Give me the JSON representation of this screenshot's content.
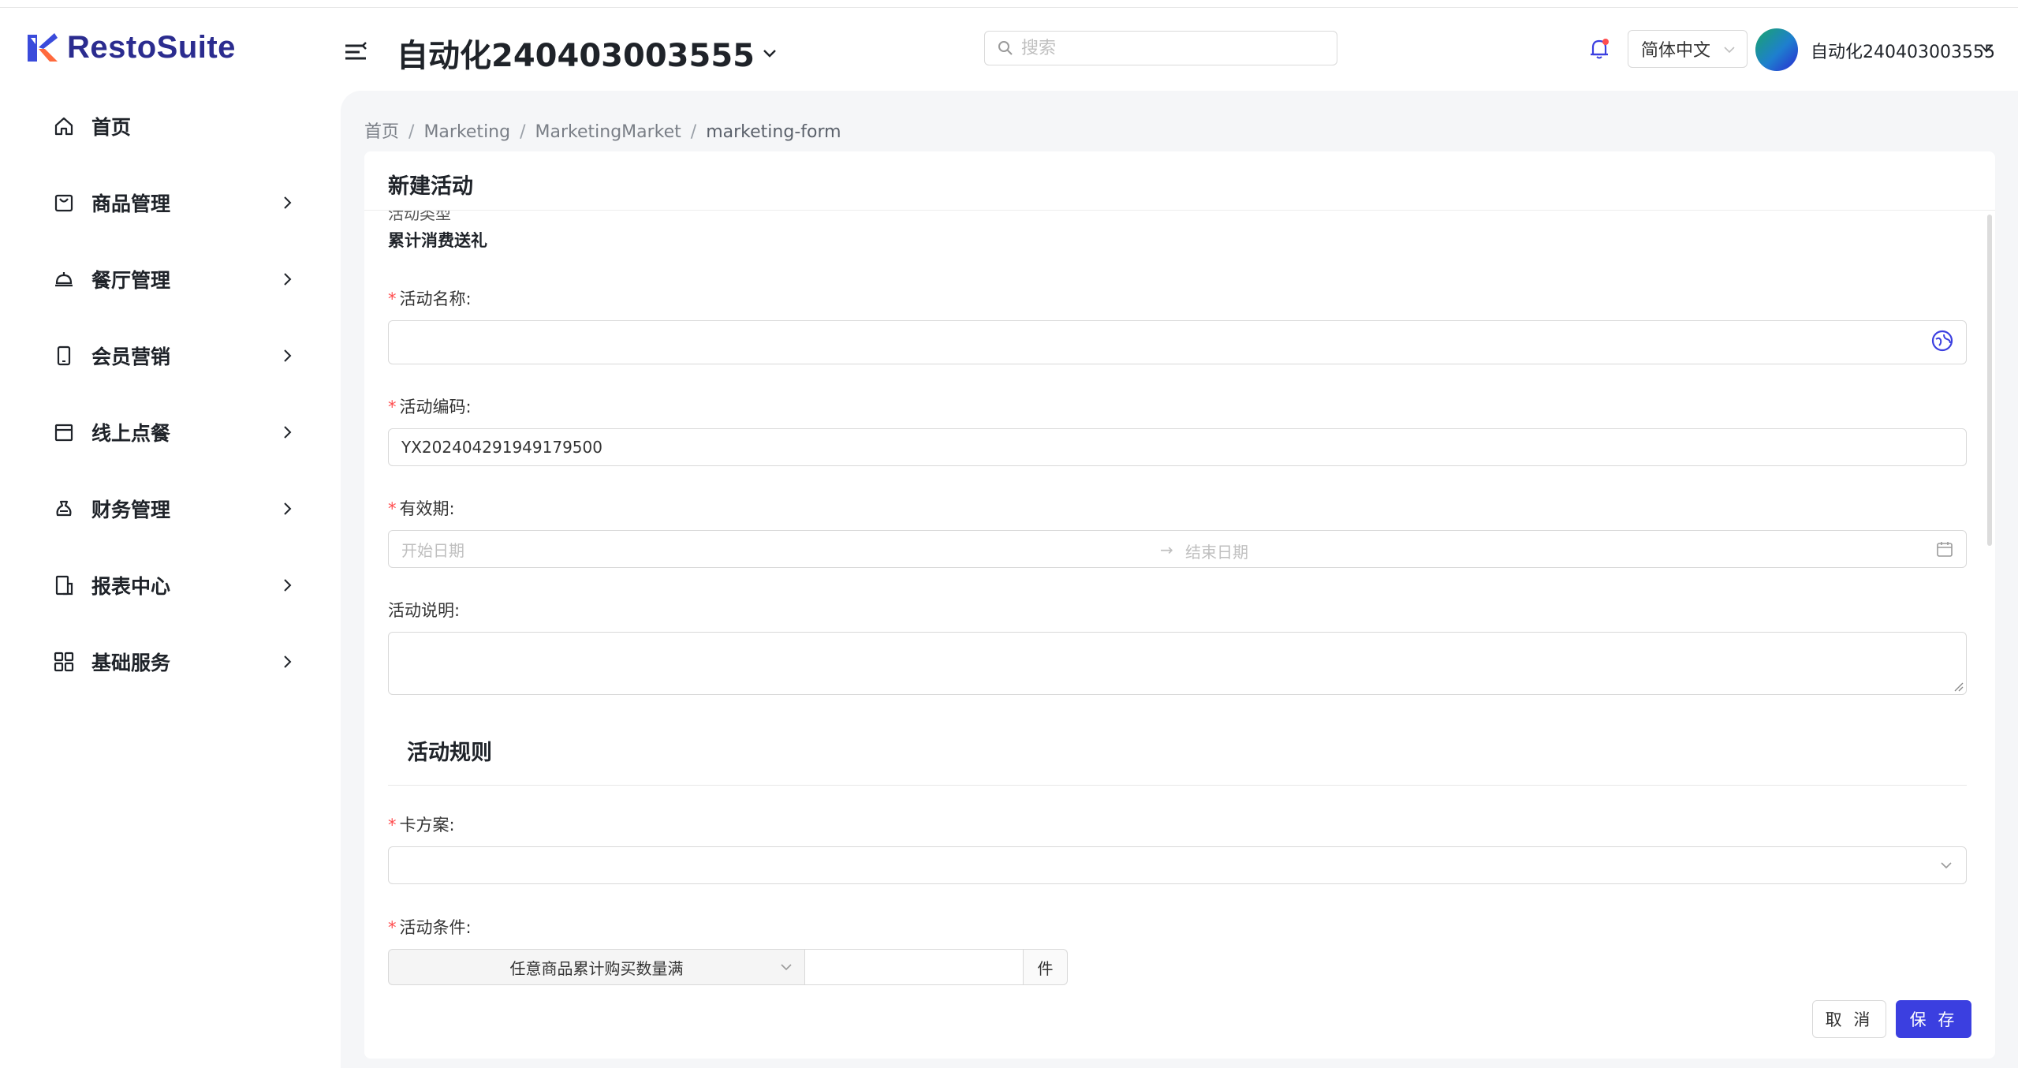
{
  "app": {
    "name": "RestoSuite"
  },
  "header": {
    "store_name": "自动化240403003555",
    "search_placeholder": "搜索",
    "language": "简体中文",
    "user_name": "自动化240403003555"
  },
  "sidebar": {
    "items": [
      {
        "label": "首页",
        "icon": "home-icon"
      },
      {
        "label": "商品管理",
        "icon": "bag-icon"
      },
      {
        "label": "餐厅管理",
        "icon": "cloche-icon"
      },
      {
        "label": "会员营销",
        "icon": "phone-icon"
      },
      {
        "label": "线上点餐",
        "icon": "store-icon"
      },
      {
        "label": "财务管理",
        "icon": "money-bag-icon"
      },
      {
        "label": "报表中心",
        "icon": "report-icon"
      },
      {
        "label": "基础服务",
        "icon": "grid-icon"
      }
    ]
  },
  "breadcrumb": [
    "首页",
    "Marketing",
    "MarketingMarket",
    "marketing-form"
  ],
  "form": {
    "title": "新建活动",
    "cut_label": "活动类型",
    "activity_type": "累计消费送礼",
    "name_label": "活动名称:",
    "name_value": "",
    "code_label": "活动编码:",
    "code_value": "YX202404291949179500",
    "validity_label": "有效期:",
    "start_placeholder": "开始日期",
    "end_placeholder": "结束日期",
    "desc_label": "活动说明:",
    "rules_title": "活动规则",
    "card_plan_label": "卡方案:",
    "condition_label": "活动条件:",
    "condition_option": "任意商品累计购买数量满",
    "condition_unit": "件",
    "cancel": "取 消",
    "save": "保 存"
  },
  "colors": {
    "brand": "#2b2c8f",
    "primary": "#3b3fe0",
    "required": "#ff4d4f"
  }
}
